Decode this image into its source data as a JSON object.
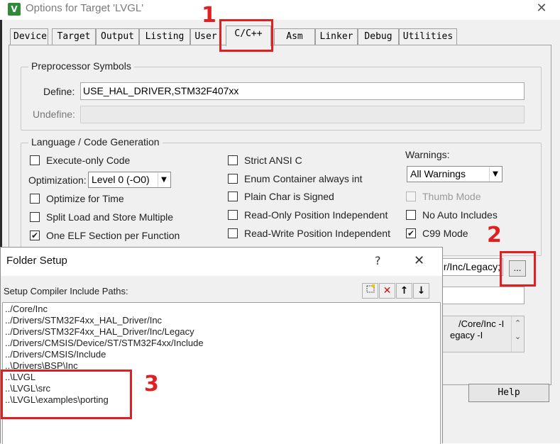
{
  "window": {
    "title": "Options for Target 'LVGL'",
    "close_glyph": "✕",
    "app_icon_glyph": "V"
  },
  "tabs": [
    "Device",
    "Target",
    "Output",
    "Listing",
    "User",
    "C/C++",
    "Asm",
    "Linker",
    "Debug",
    "Utilities"
  ],
  "active_tab": "C/C++",
  "preprocessor": {
    "group_title": "Preprocessor Symbols",
    "define_label": "Define:",
    "define_value": "USE_HAL_DRIVER,STM32F407xx",
    "undefine_label": "Undefine:",
    "undefine_value": ""
  },
  "codegen": {
    "group_title": "Language / Code Generation",
    "execute_only": {
      "label": "Execute-only Code",
      "checked": false
    },
    "optimization_label": "Optimization:",
    "optimization_value": "Level 0 (-O0)",
    "optimize_time": {
      "label": "Optimize for Time",
      "checked": false
    },
    "split_load_store": {
      "label": "Split Load and Store Multiple",
      "checked": false
    },
    "one_elf_section": {
      "label": "One ELF Section per Function",
      "checked": true
    },
    "strict_ansi": {
      "label": "Strict ANSI C",
      "checked": false
    },
    "enum_container": {
      "label": "Enum Container always int",
      "checked": false
    },
    "plain_char_signed": {
      "label": "Plain Char is Signed",
      "checked": false
    },
    "ro_pos_indep": {
      "label": "Read-Only Position Independent",
      "checked": false
    },
    "rw_pos_indep": {
      "label": "Read-Write Position Independent",
      "checked": false
    },
    "warnings_label": "Warnings:",
    "warnings_value": "All Warnings",
    "thumb_mode": {
      "label": "Thumb Mode",
      "checked": false,
      "disabled": true
    },
    "no_auto_includes": {
      "label": "No Auto Includes",
      "checked": false
    },
    "c99_mode": {
      "label": "C99 Mode",
      "checked": true
    }
  },
  "include_paths_visible": "r/Inc/Legacy;",
  "browse_button_label": "...",
  "compiler_string_lines": [
    "/Core/Inc -I",
    "egacy -I"
  ],
  "help_button_label": "Help",
  "folder_setup": {
    "title": "Folder Setup",
    "help_glyph": "?",
    "close_glyph": "✕",
    "label": "Setup Compiler Include Paths:",
    "toolbar_icons": [
      "new-folder-icon",
      "delete-icon",
      "move-up-icon",
      "move-down-icon"
    ],
    "paths": [
      "../Core/Inc",
      "../Drivers/STM32F4xx_HAL_Driver/Inc",
      "../Drivers/STM32F4xx_HAL_Driver/Inc/Legacy",
      "../Drivers/CMSIS/Device/ST/STM32F4xx/Include",
      "../Drivers/CMSIS/Include",
      "..\\Drivers\\BSP\\Inc",
      "..\\LVGL",
      "..\\LVGL\\src",
      "..\\LVGL\\examples\\porting"
    ]
  },
  "annotations": [
    "1",
    "2",
    "3"
  ],
  "colors": {
    "annotation_red": "#e02020",
    "dialog_bg": "#f0f0f0"
  }
}
